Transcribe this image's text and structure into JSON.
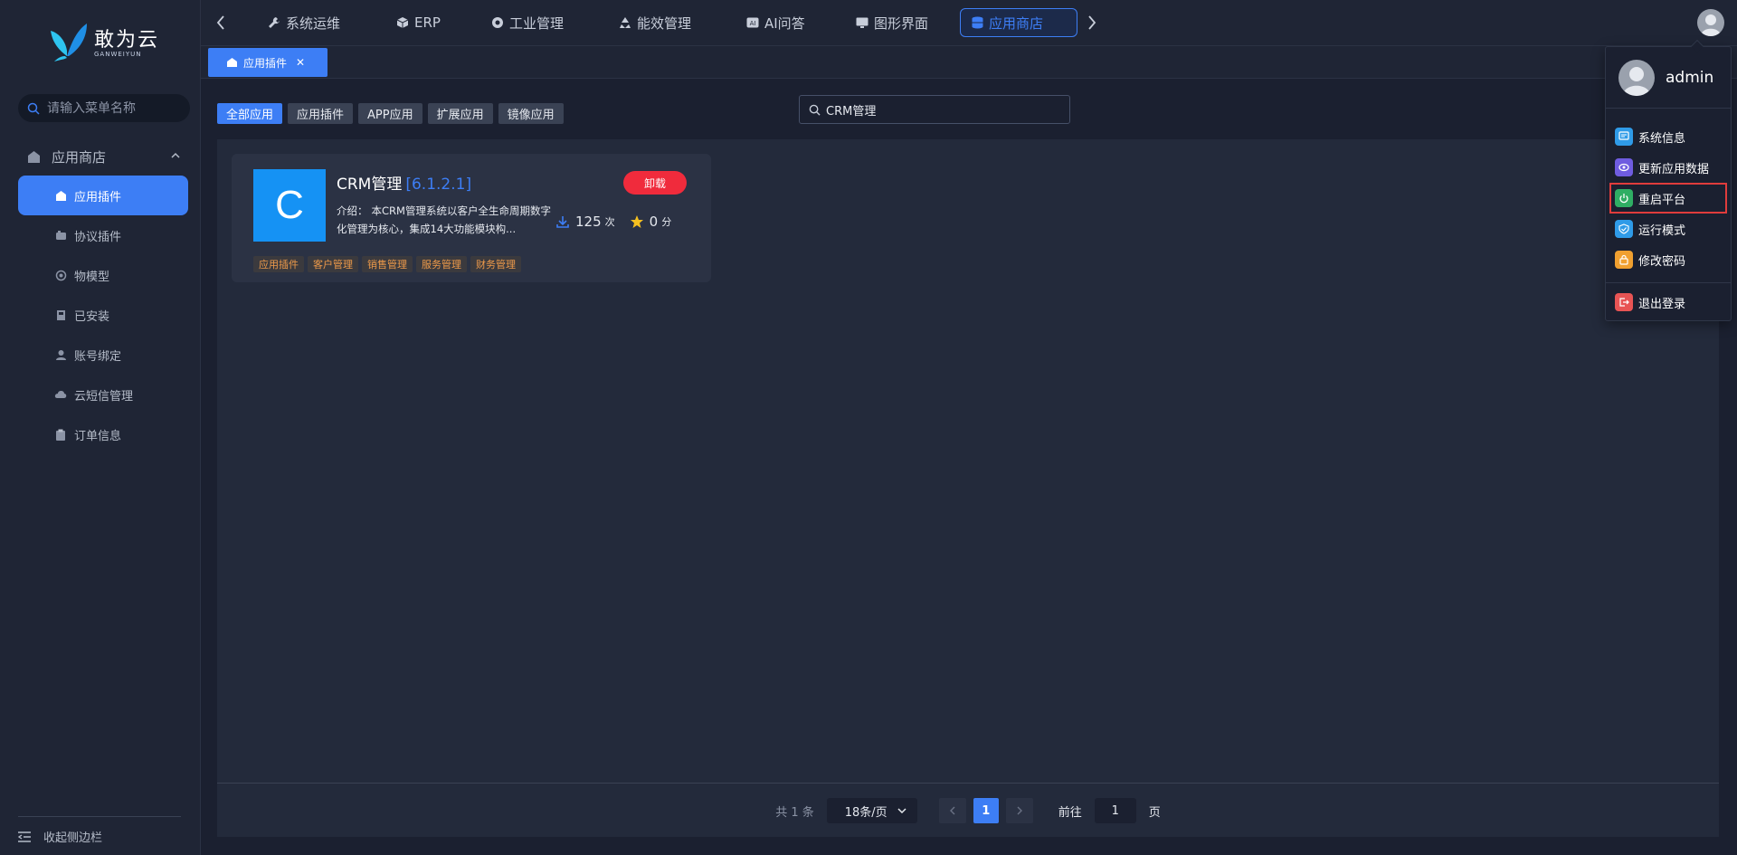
{
  "brand": {
    "name_cn": "敢为云",
    "name_en": "GANWEIYUN"
  },
  "sidebar": {
    "search_placeholder": "请输入菜单名称",
    "group_label": "应用商店",
    "items": [
      {
        "label": "应用插件",
        "icon": "store-icon",
        "active": true
      },
      {
        "label": "协议插件",
        "icon": "plugin-icon"
      },
      {
        "label": "物模型",
        "icon": "model-icon"
      },
      {
        "label": "已安装",
        "icon": "installed-icon"
      },
      {
        "label": "账号绑定",
        "icon": "user-icon"
      },
      {
        "label": "云短信管理",
        "icon": "cloud-icon"
      },
      {
        "label": "订单信息",
        "icon": "clipboard-icon"
      }
    ],
    "collapse_label": "收起侧边栏"
  },
  "topnav": {
    "tabs": [
      {
        "label": "系统运维",
        "icon": "wrench-icon"
      },
      {
        "label": "ERP",
        "icon": "cube-icon"
      },
      {
        "label": "工业管理",
        "icon": "gear-icon"
      },
      {
        "label": "能效管理",
        "icon": "recycle-icon"
      },
      {
        "label": "AI问答",
        "icon": "ai-icon"
      },
      {
        "label": "图形界面",
        "icon": "monitor-icon"
      },
      {
        "label": "应用商店",
        "icon": "database-icon",
        "active": true
      }
    ]
  },
  "page_tab": {
    "label": "应用插件"
  },
  "filters": {
    "buttons": [
      "全部应用",
      "应用插件",
      "APP应用",
      "扩展应用",
      "镜像应用"
    ],
    "active": "全部应用",
    "search_value": "CRM管理"
  },
  "app_card": {
    "logo_letter": "C",
    "name": "CRM管理",
    "version": "[6.1.2.1]",
    "action_label": "卸载",
    "desc_label": "介绍：",
    "desc": "本CRM管理系统以客户全生命周期数字化管理为核心，集成14大功能模块构...",
    "downloads": "125",
    "downloads_unit": "次",
    "rating": "0",
    "rating_unit": "分",
    "tags": [
      "应用插件",
      "客户管理",
      "销售管理",
      "服务管理",
      "财务管理"
    ]
  },
  "pagination": {
    "total_text": "共 1 条",
    "page_size": "18条/页",
    "current_page": "1",
    "goto_label": "前往",
    "goto_value": "1",
    "page_unit": "页"
  },
  "user_menu": {
    "username": "admin",
    "items": [
      {
        "label": "系统信息",
        "color": "#2f9be8"
      },
      {
        "label": "更新应用数据",
        "color": "#6f5ce0"
      },
      {
        "label": "重启平台",
        "color": "#2fae64",
        "highlighted": true
      },
      {
        "label": "运行模式",
        "color": "#2f9be8"
      },
      {
        "label": "修改密码",
        "color": "#f0a030"
      }
    ],
    "logout_label": "退出登录",
    "logout_color": "#e85454"
  },
  "colors": {
    "accent": "#3d7ef5",
    "danger": "#f02b3c",
    "tag": "#ee9a4a"
  }
}
